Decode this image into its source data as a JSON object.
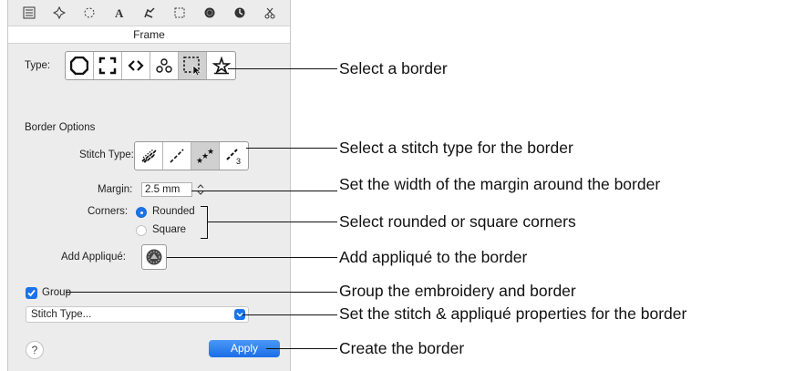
{
  "panel": {
    "title": "Frame",
    "toolbar_icons": [
      "list-icon",
      "sparkle-icon",
      "dotted-circle-icon",
      "text-a-icon",
      "hand-stitch-icon",
      "dotted-square-icon",
      "filled-circle-icon",
      "clock-icon",
      "scissors-icon"
    ],
    "type_label": "Type:",
    "border_types": [
      "octagon-border-icon",
      "corner-brackets-border-icon",
      "angle-brackets-border-icon",
      "flourish-border-icon",
      "dotted-square-border-icon",
      "star-border-icon"
    ],
    "border_options_label": "Border Options",
    "stitch_type_label": "Stitch Type:",
    "stitch_types": [
      "satin-stitch-icon",
      "running-stitch-icon",
      "motif-stitch-icon",
      "triple-stitch-icon"
    ],
    "margin_label": "Margin:",
    "margin_value": "2.5 mm",
    "corners_label": "Corners:",
    "corner_options": [
      "Rounded",
      "Square"
    ],
    "corner_selected": "Rounded",
    "add_applique_label": "Add Appliqué:",
    "group_label": "Group",
    "group_checked": true,
    "dropdown_value": "Stitch Type...",
    "help_label": "?",
    "apply_label": "Apply"
  },
  "annotations": {
    "select_border": "Select a border",
    "select_stitch": "Select a stitch type for the border",
    "margin": "Set the width of the margin around the border",
    "corners": "Select rounded or square corners",
    "applique": "Add appliqué to the border",
    "group": "Group the embroidery and border",
    "properties": "Set the stitch & appliqué properties for the border",
    "create": "Create the border"
  },
  "colors": {
    "accent": "#1a73e8",
    "panel_bg": "#ececec"
  }
}
